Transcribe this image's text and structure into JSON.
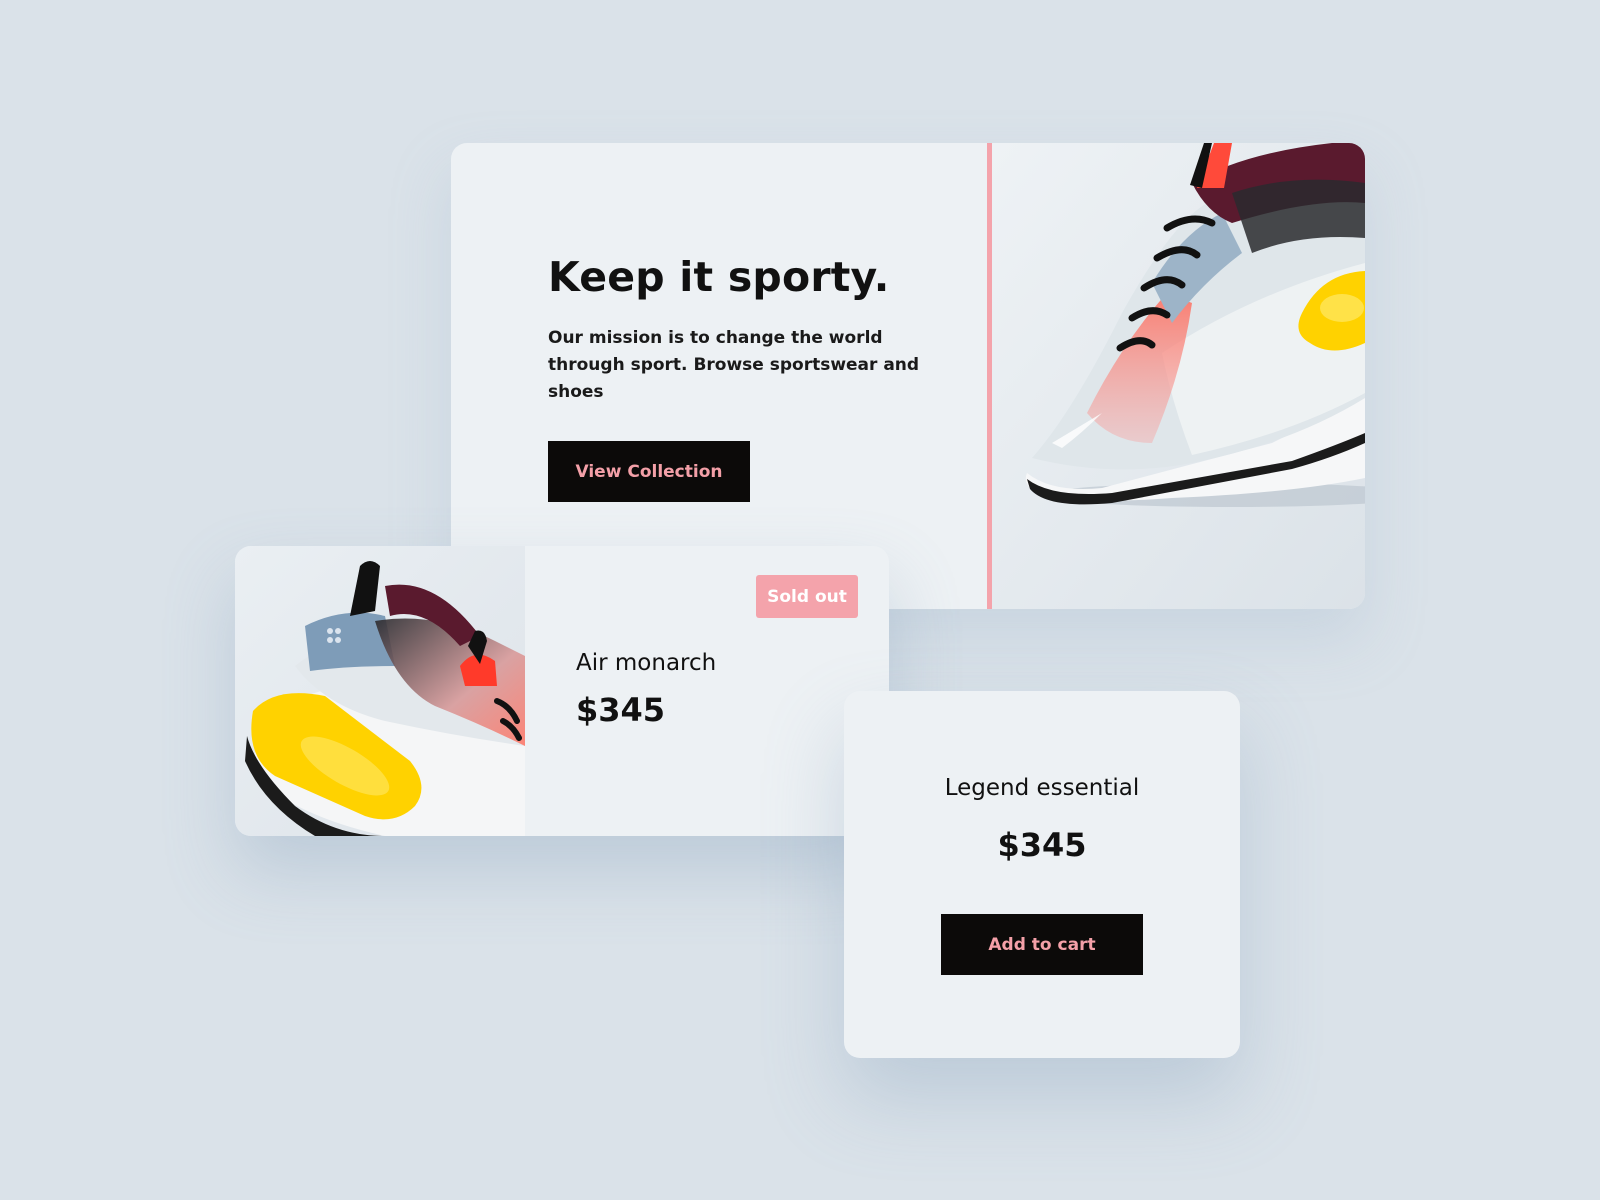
{
  "hero": {
    "title": "Keep it sporty.",
    "description": "Our mission is to change the world through sport. Browse sportswear and shoes",
    "cta_label": "View Collection",
    "image_alt": "sneaker-photo"
  },
  "products": [
    {
      "name": "Air monarch",
      "price": "$345",
      "badge": "Sold out",
      "image_alt": "sneaker-photo"
    },
    {
      "name": "Legend essential",
      "price": "$345",
      "cta_label": "Add to cart"
    }
  ],
  "colors": {
    "background": "#dae2e9",
    "card": "#edf1f4",
    "accent_pink": "#f4a3ab",
    "button_dark": "#0c0a09",
    "text_dark": "#111111",
    "shoe_yellow": "#ffd200",
    "shoe_burgundy": "#5a1a2e",
    "shoe_red": "#ff4a3a"
  }
}
